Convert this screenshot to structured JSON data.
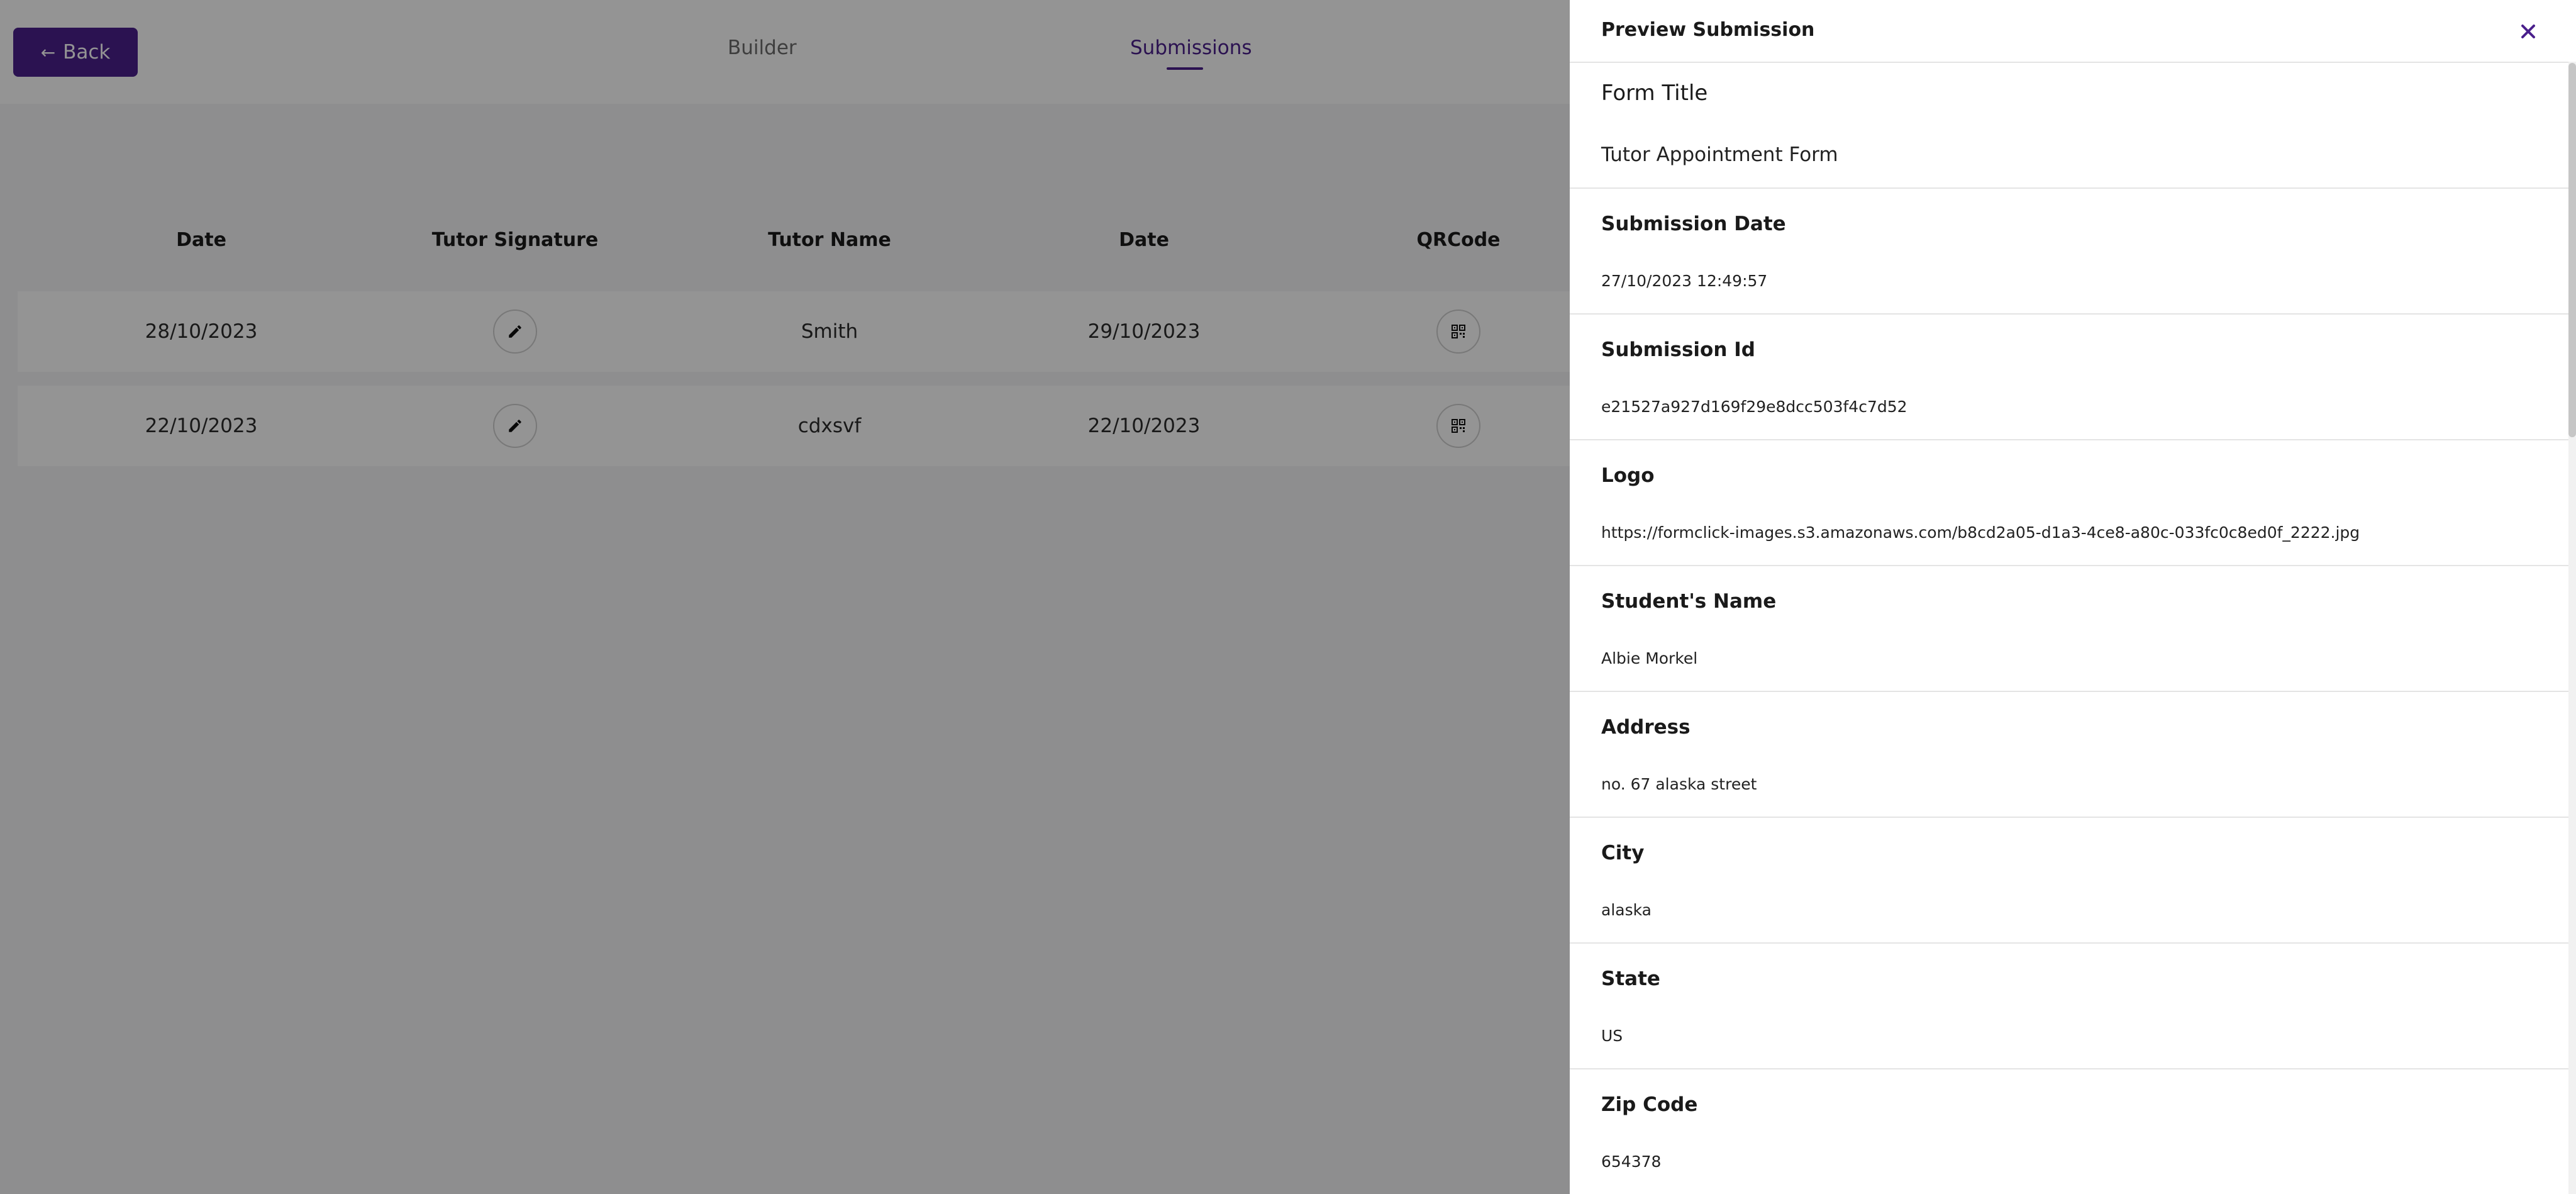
{
  "nav": {
    "back_label": "Back",
    "tabs": [
      {
        "label": "Builder",
        "active": false
      },
      {
        "label": "Submissions",
        "active": true
      }
    ]
  },
  "table": {
    "headers": [
      "Date",
      "Tutor Signature",
      "Tutor Name",
      "Date",
      "QRCode"
    ],
    "rows": [
      {
        "date": "28/10/2023",
        "signature_icon": "pencil-icon",
        "tutor_name": "Smith",
        "date2": "29/10/2023",
        "qrcode_icon": "qrcode-icon"
      },
      {
        "date": "22/10/2023",
        "signature_icon": "pencil-icon",
        "tutor_name": "cdxsvf",
        "date2": "22/10/2023",
        "qrcode_icon": "qrcode-icon"
      }
    ]
  },
  "drawer": {
    "title": "Preview Submission",
    "close_icon": "close-icon",
    "fields": [
      {
        "label": "Form Title",
        "value": "Tutor Appointment Form"
      },
      {
        "label": "Submission Date",
        "value": "27/10/2023 12:49:57"
      },
      {
        "label": "Submission Id",
        "value": "e21527a927d169f29e8dcc503f4c7d52"
      },
      {
        "label": "Logo",
        "value": "https://formclick-images.s3.amazonaws.com/b8cd2a05-d1a3-4ce8-a80c-033fc0c8ed0f_2222.jpg"
      },
      {
        "label": "Student's Name",
        "value": "Albie Morkel"
      },
      {
        "label": "Address",
        "value": "no. 67 alaska street"
      },
      {
        "label": "City",
        "value": "alaska"
      },
      {
        "label": "State",
        "value": "US"
      },
      {
        "label": "Zip Code",
        "value": "654378"
      }
    ]
  },
  "colors": {
    "accent": "#4a1f8c",
    "overlay": "#000000",
    "panel": "#ffffff"
  }
}
